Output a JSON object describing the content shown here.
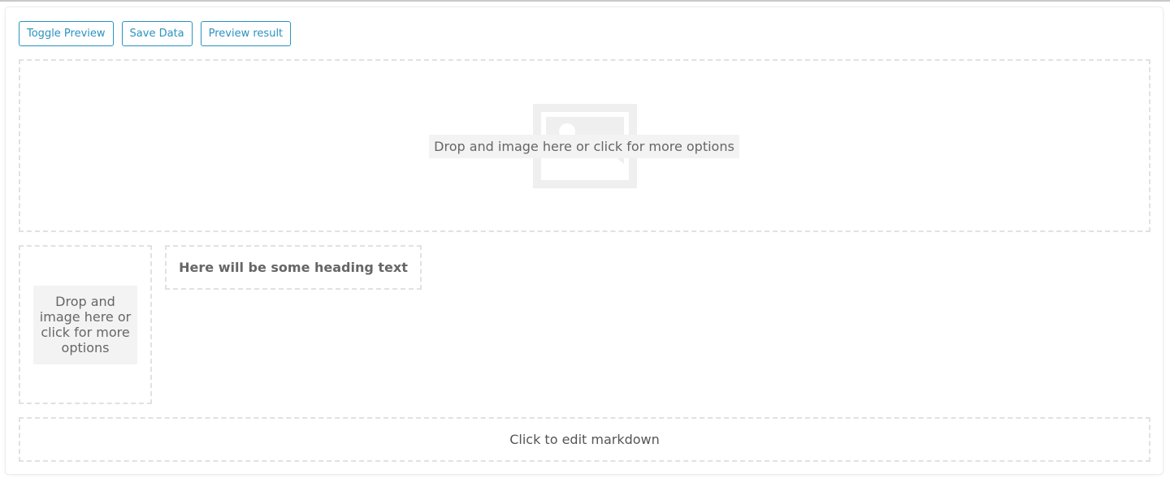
{
  "toolbar": {
    "toggle_preview": "Toggle Preview",
    "save_data": "Save Data",
    "preview_result": "Preview result"
  },
  "hero_image": {
    "caption": "Drop and image here or click for more options",
    "icon": "image-placeholder-icon"
  },
  "small_image": {
    "caption": "Drop and image here or click for more options"
  },
  "heading": {
    "text": "Here will be some heading text"
  },
  "markdown": {
    "text": "Click to edit markdown"
  },
  "colors": {
    "accent": "#2a93c0",
    "dashed_border": "#e1e1e1",
    "placeholder": "#f0f0f0",
    "text": "#666666"
  }
}
